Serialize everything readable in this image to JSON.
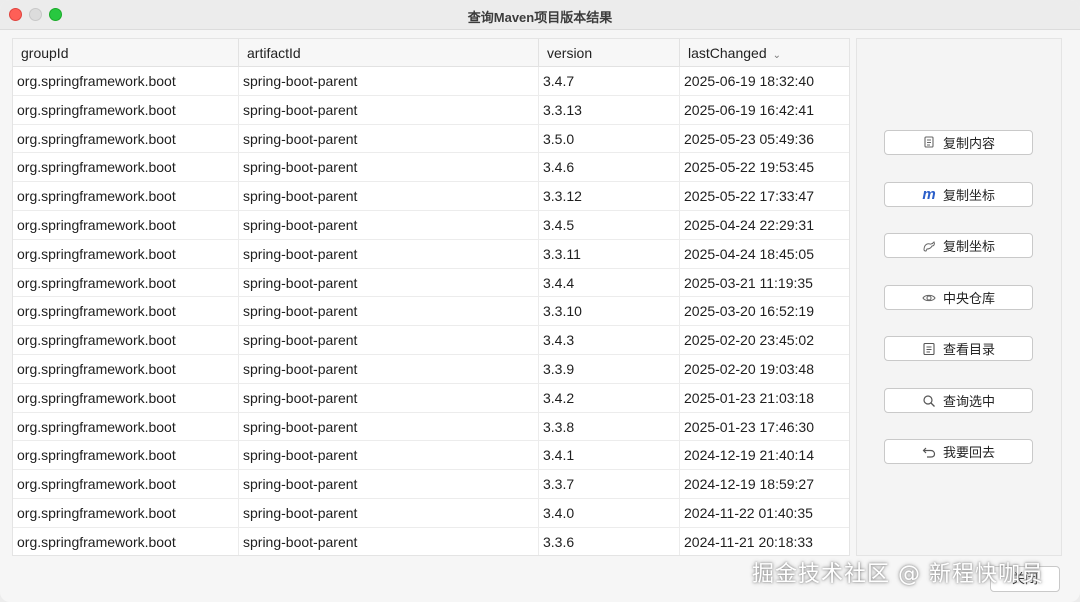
{
  "window": {
    "title": "查询Maven项目版本结果"
  },
  "table": {
    "columns": [
      "groupId",
      "artifactId",
      "version",
      "lastChanged"
    ],
    "rows": [
      [
        "org.springframework.boot",
        "spring-boot-parent",
        "3.4.7",
        "2025-06-19 18:32:40"
      ],
      [
        "org.springframework.boot",
        "spring-boot-parent",
        "3.3.13",
        "2025-06-19 16:42:41"
      ],
      [
        "org.springframework.boot",
        "spring-boot-parent",
        "3.5.0",
        "2025-05-23 05:49:36"
      ],
      [
        "org.springframework.boot",
        "spring-boot-parent",
        "3.4.6",
        "2025-05-22 19:53:45"
      ],
      [
        "org.springframework.boot",
        "spring-boot-parent",
        "3.3.12",
        "2025-05-22 17:33:47"
      ],
      [
        "org.springframework.boot",
        "spring-boot-parent",
        "3.4.5",
        "2025-04-24 22:29:31"
      ],
      [
        "org.springframework.boot",
        "spring-boot-parent",
        "3.3.11",
        "2025-04-24 18:45:05"
      ],
      [
        "org.springframework.boot",
        "spring-boot-parent",
        "3.4.4",
        "2025-03-21 11:19:35"
      ],
      [
        "org.springframework.boot",
        "spring-boot-parent",
        "3.3.10",
        "2025-03-20 16:52:19"
      ],
      [
        "org.springframework.boot",
        "spring-boot-parent",
        "3.4.3",
        "2025-02-20 23:45:02"
      ],
      [
        "org.springframework.boot",
        "spring-boot-parent",
        "3.3.9",
        "2025-02-20 19:03:48"
      ],
      [
        "org.springframework.boot",
        "spring-boot-parent",
        "3.4.2",
        "2025-01-23 21:03:18"
      ],
      [
        "org.springframework.boot",
        "spring-boot-parent",
        "3.3.8",
        "2025-01-23 17:46:30"
      ],
      [
        "org.springframework.boot",
        "spring-boot-parent",
        "3.4.1",
        "2024-12-19 21:40:14"
      ],
      [
        "org.springframework.boot",
        "spring-boot-parent",
        "3.3.7",
        "2024-12-19 18:59:27"
      ],
      [
        "org.springframework.boot",
        "spring-boot-parent",
        "3.4.0",
        "2024-11-22 01:40:35"
      ],
      [
        "org.springframework.boot",
        "spring-boot-parent",
        "3.3.6",
        "2024-11-21 20:18:33"
      ]
    ]
  },
  "buttons": {
    "copy_content": "复制内容",
    "copy_coord_maven": "复制坐标",
    "copy_coord_gradle": "复制坐标",
    "central_repo": "中央仓库",
    "view_directory": "查看目录",
    "query_selected": "查询选中",
    "go_back": "我要回去",
    "close": "关闭"
  },
  "watermark": "掘金技术社区 @ 新程快咖员"
}
